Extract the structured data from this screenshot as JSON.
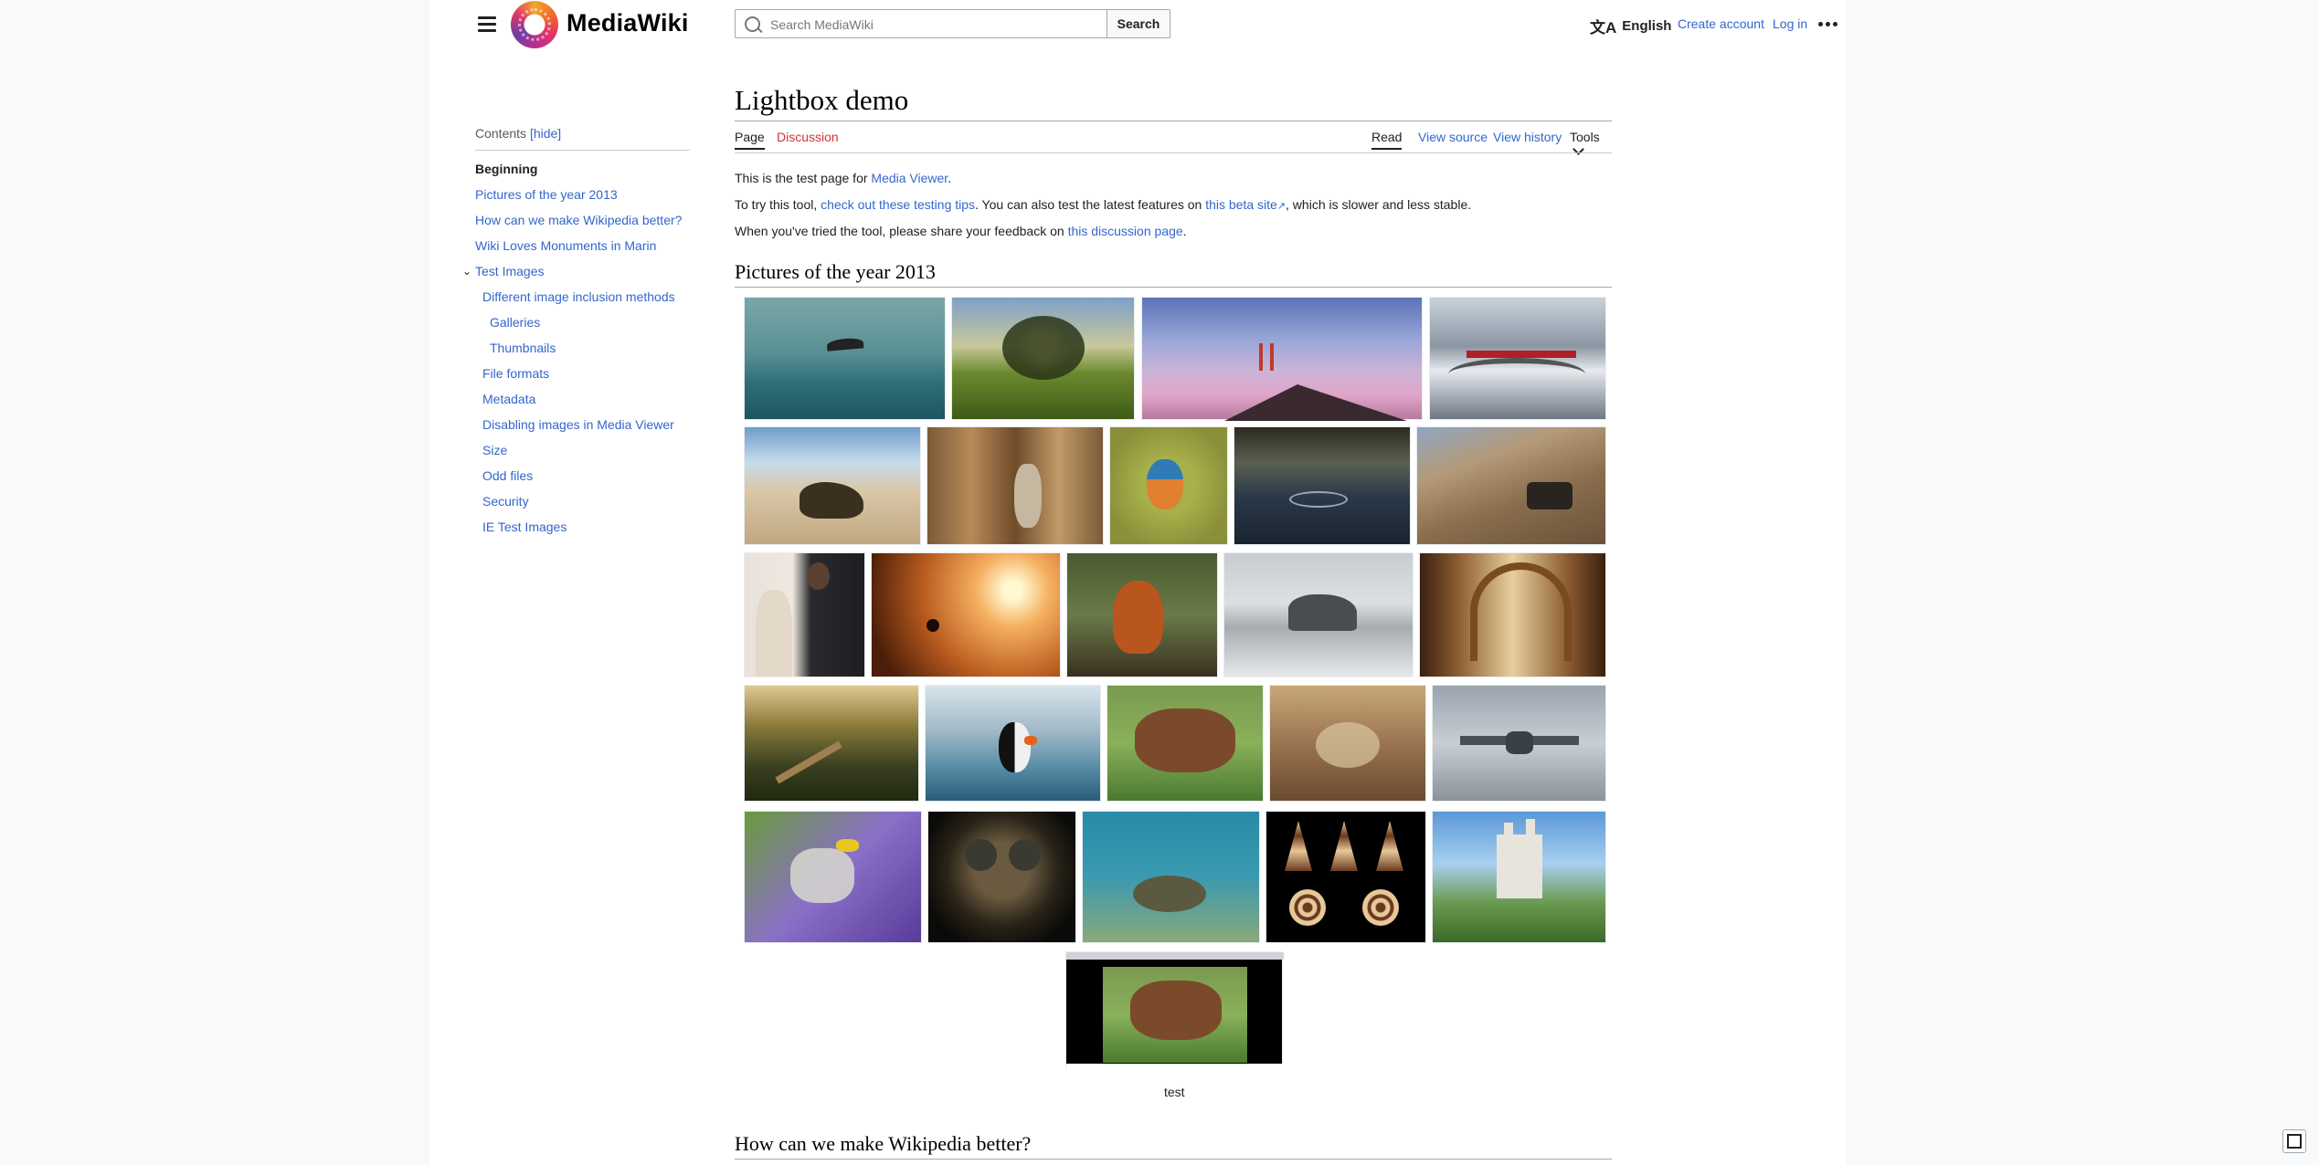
{
  "header": {
    "logo_text": "MediaWiki",
    "search_placeholder": "Search MediaWiki",
    "search_button": "Search",
    "language": "English",
    "create_account": "Create account",
    "log_in": "Log in"
  },
  "toc": {
    "title": "Contents",
    "hide": "[hide]",
    "items": [
      "Beginning",
      "Pictures of the year 2013",
      "How can we make Wikipedia better?",
      "Wiki Loves Monuments in Marin",
      "Test Images",
      "Different image inclusion methods",
      "Galleries",
      "Thumbnails",
      "File formats",
      "Metadata",
      "Disabling images in Media Viewer",
      "Size",
      "Odd files",
      "Security",
      "IE Test Images"
    ]
  },
  "page": {
    "title": "Lightbox demo",
    "tabs": {
      "page": "Page",
      "discussion": "Discussion",
      "read": "Read",
      "view_source": "View source",
      "view_history": "View history",
      "tools": "Tools"
    },
    "p1": {
      "text": "This is the test page for ",
      "link": "Media Viewer",
      "end": "."
    },
    "p2": {
      "text1": "To try this tool, ",
      "link1": "check out these testing tips",
      "text2": ". You can also test the latest features on ",
      "link2": "this beta site",
      "text3": ", which is slower and less stable."
    },
    "p3": {
      "text": "When you've tried the tool, please share your feedback on ",
      "link": "this discussion page",
      "end": "."
    },
    "section1": "Pictures of the year 2013",
    "caption": "test",
    "section2": "How can we make Wikipedia better?"
  },
  "colors": {
    "link": "#3366cc",
    "new_link": "#d73333",
    "text": "#202122",
    "background": "#f8f9fa"
  },
  "icons": [
    "menu-icon",
    "search-icon",
    "language-icon",
    "more-icon",
    "chevron-down-icon",
    "external-link-icon",
    "fullscreen-icon"
  ]
}
